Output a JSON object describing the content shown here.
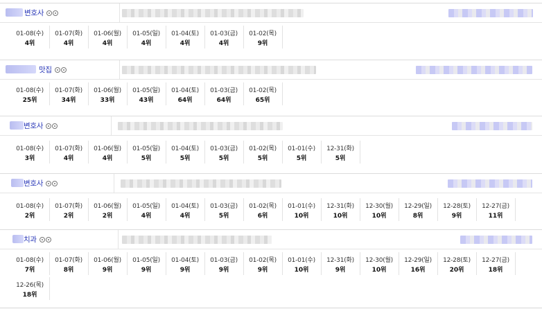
{
  "blocks": [
    {
      "name": "변호사",
      "name_prefix_blur": true,
      "ranks": [
        {
          "date": "01-08(수)",
          "rank": "4위"
        },
        {
          "date": "01-07(화)",
          "rank": "4위"
        },
        {
          "date": "01-06(월)",
          "rank": "4위"
        },
        {
          "date": "01-05(일)",
          "rank": "4위"
        },
        {
          "date": "01-04(토)",
          "rank": "4위"
        },
        {
          "date": "01-03(금)",
          "rank": "4위"
        },
        {
          "date": "01-02(목)",
          "rank": "9위"
        }
      ]
    },
    {
      "name": "맛집",
      "name_prefix_blur": true,
      "ranks": [
        {
          "date": "01-08(수)",
          "rank": "25위"
        },
        {
          "date": "01-07(화)",
          "rank": "34위"
        },
        {
          "date": "01-06(월)",
          "rank": "33위"
        },
        {
          "date": "01-05(일)",
          "rank": "43위"
        },
        {
          "date": "01-04(토)",
          "rank": "64위"
        },
        {
          "date": "01-03(금)",
          "rank": "64위"
        },
        {
          "date": "01-02(목)",
          "rank": "65위"
        }
      ]
    },
    {
      "name": "변호사",
      "name_prefix_blur": true,
      "ranks": [
        {
          "date": "01-08(수)",
          "rank": "3위"
        },
        {
          "date": "01-07(화)",
          "rank": "4위"
        },
        {
          "date": "01-06(월)",
          "rank": "4위"
        },
        {
          "date": "01-05(일)",
          "rank": "5위"
        },
        {
          "date": "01-04(토)",
          "rank": "5위"
        },
        {
          "date": "01-03(금)",
          "rank": "5위"
        },
        {
          "date": "01-02(목)",
          "rank": "5위"
        },
        {
          "date": "01-01(수)",
          "rank": "5위"
        },
        {
          "date": "12-31(화)",
          "rank": "5위"
        }
      ]
    },
    {
      "name": "변호사",
      "name_prefix_blur": true,
      "ranks": [
        {
          "date": "01-08(수)",
          "rank": "2위"
        },
        {
          "date": "01-07(화)",
          "rank": "2위"
        },
        {
          "date": "01-06(월)",
          "rank": "2위"
        },
        {
          "date": "01-05(일)",
          "rank": "4위"
        },
        {
          "date": "01-04(토)",
          "rank": "4위"
        },
        {
          "date": "01-03(금)",
          "rank": "5위"
        },
        {
          "date": "01-02(목)",
          "rank": "6위"
        },
        {
          "date": "01-01(수)",
          "rank": "10위"
        },
        {
          "date": "12-31(화)",
          "rank": "10위"
        },
        {
          "date": "12-30(월)",
          "rank": "10위"
        },
        {
          "date": "12-29(일)",
          "rank": "8위"
        },
        {
          "date": "12-28(토)",
          "rank": "9위"
        },
        {
          "date": "12-27(금)",
          "rank": "11위"
        }
      ]
    },
    {
      "name": "치과",
      "name_prefix_blur": true,
      "ranks": [
        {
          "date": "01-08(수)",
          "rank": "7위"
        },
        {
          "date": "01-07(화)",
          "rank": "8위"
        },
        {
          "date": "01-06(월)",
          "rank": "9위"
        },
        {
          "date": "01-05(일)",
          "rank": "9위"
        },
        {
          "date": "01-04(토)",
          "rank": "9위"
        },
        {
          "date": "01-03(금)",
          "rank": "9위"
        },
        {
          "date": "01-02(목)",
          "rank": "9위"
        },
        {
          "date": "01-01(수)",
          "rank": "10위"
        },
        {
          "date": "12-31(화)",
          "rank": "9위"
        },
        {
          "date": "12-30(월)",
          "rank": "10위"
        },
        {
          "date": "12-29(일)",
          "rank": "16위"
        },
        {
          "date": "12-28(토)",
          "rank": "20위"
        },
        {
          "date": "12-27(금)",
          "rank": "18위"
        },
        {
          "date": "12-26(목)",
          "rank": "18위"
        }
      ]
    }
  ]
}
